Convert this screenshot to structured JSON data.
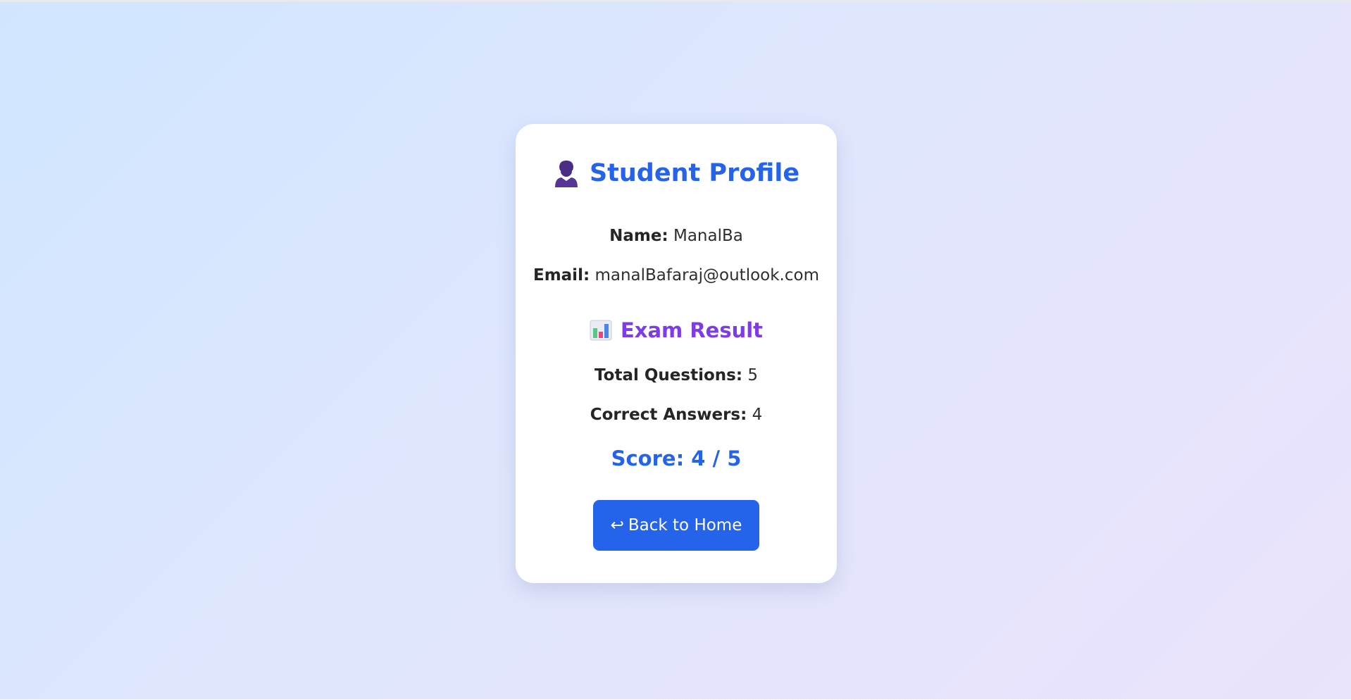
{
  "profile": {
    "title": "Student Profile",
    "title_icon": "user-icon",
    "name_label": "Name:",
    "name_value": "ManalBa",
    "email_label": "Email:",
    "email_value": "manalBafaraj@outlook.com"
  },
  "result": {
    "title": "Exam Result",
    "title_icon": "bar-chart-icon",
    "total_label": "Total Questions:",
    "total_value": "5",
    "correct_label": "Correct Answers:",
    "correct_value": "4",
    "score_text": "Score: 4 / 5"
  },
  "button": {
    "icon": "return-arrow-icon",
    "icon_glyph": "↩",
    "label": "Back to Home"
  },
  "colors": {
    "primary": "#2563eb",
    "accent": "#7e3ce6"
  }
}
